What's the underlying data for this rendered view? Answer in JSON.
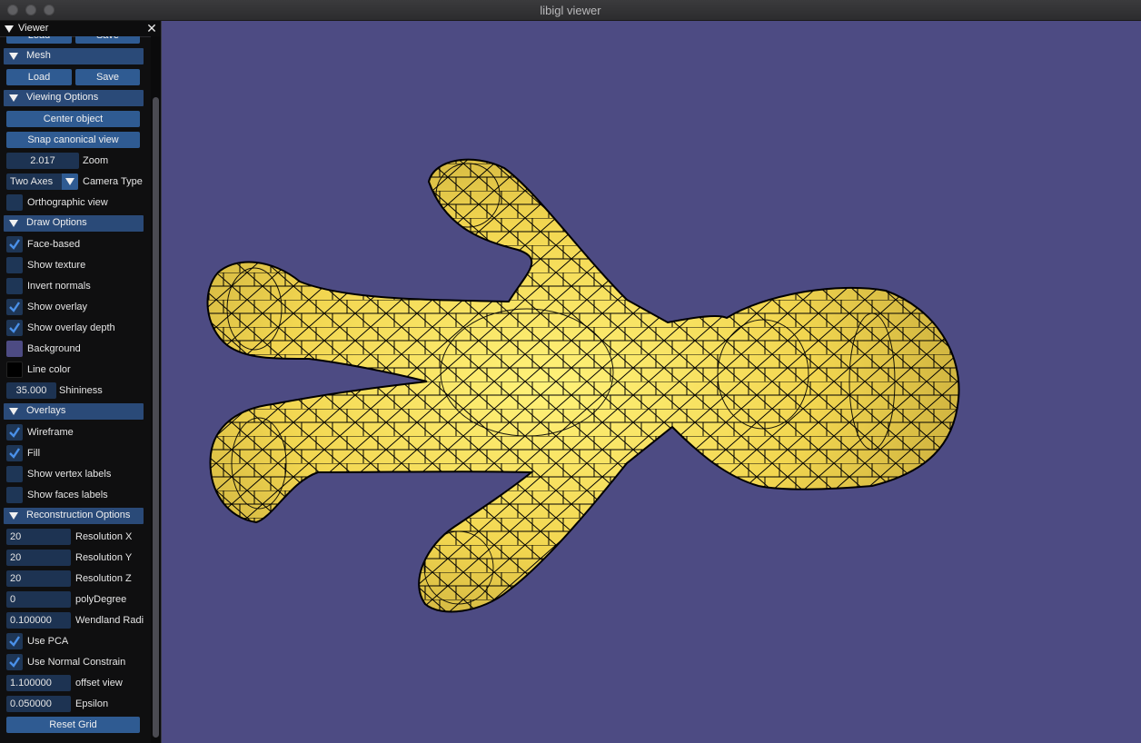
{
  "window": {
    "title": "libigl viewer"
  },
  "panel": {
    "title": "Viewer",
    "partial_load_label": "Load",
    "partial_save_label": "Save",
    "mesh": {
      "header": "Mesh",
      "load": "Load",
      "save": "Save"
    },
    "viewing": {
      "header": "Viewing Options",
      "center_object": "Center object",
      "snap_canonical": "Snap canonical view",
      "zoom_value": "2.017",
      "zoom_label": "Zoom",
      "camera_type_value": "Two Axes",
      "camera_type_label": "Camera Type",
      "orthographic_label": "Orthographic view",
      "orthographic_checked": false
    },
    "draw": {
      "header": "Draw Options",
      "face_based": "Face-based",
      "face_based_checked": true,
      "show_texture": "Show texture",
      "show_texture_checked": false,
      "invert_normals": "Invert normals",
      "invert_normals_checked": false,
      "show_overlay": "Show overlay",
      "show_overlay_checked": true,
      "show_overlay_depth": "Show overlay depth",
      "show_overlay_depth_checked": true,
      "background": "Background",
      "background_color": "#4d4b83",
      "line_color": "Line color",
      "line_color_value": "#000000",
      "shininess_value": "35.000",
      "shininess_label": "Shininess"
    },
    "overlays": {
      "header": "Overlays",
      "wireframe": "Wireframe",
      "wireframe_checked": true,
      "fill": "Fill",
      "fill_checked": true,
      "vertex_labels": "Show vertex labels",
      "vertex_labels_checked": false,
      "faces_labels": "Show faces labels",
      "faces_labels_checked": false
    },
    "reconstruction": {
      "header": "Reconstruction Options",
      "res_x_value": "20",
      "res_x_label": "Resolution X",
      "res_y_value": "20",
      "res_y_label": "Resolution Y",
      "res_z_value": "20",
      "res_z_label": "Resolution Z",
      "poly_value": "0",
      "poly_label": "polyDegree",
      "wendland_value": "0.100000",
      "wendland_label": "Wendland Radi",
      "use_pca": "Use PCA",
      "use_pca_checked": true,
      "use_normal": "Use Normal Constrain",
      "use_normal_checked": true,
      "offset_value": "1.100000",
      "offset_label": "offset view",
      "epsilon_value": "0.050000",
      "epsilon_label": "Epsilon",
      "reset_grid": "Reset Grid"
    }
  },
  "colors": {
    "background": "#4d4b83",
    "mesh_fill": "#f2dc55",
    "mesh_lines": "#000000",
    "header": "#2a4a78",
    "button": "#2f5b92",
    "check": "#4a90e8"
  }
}
